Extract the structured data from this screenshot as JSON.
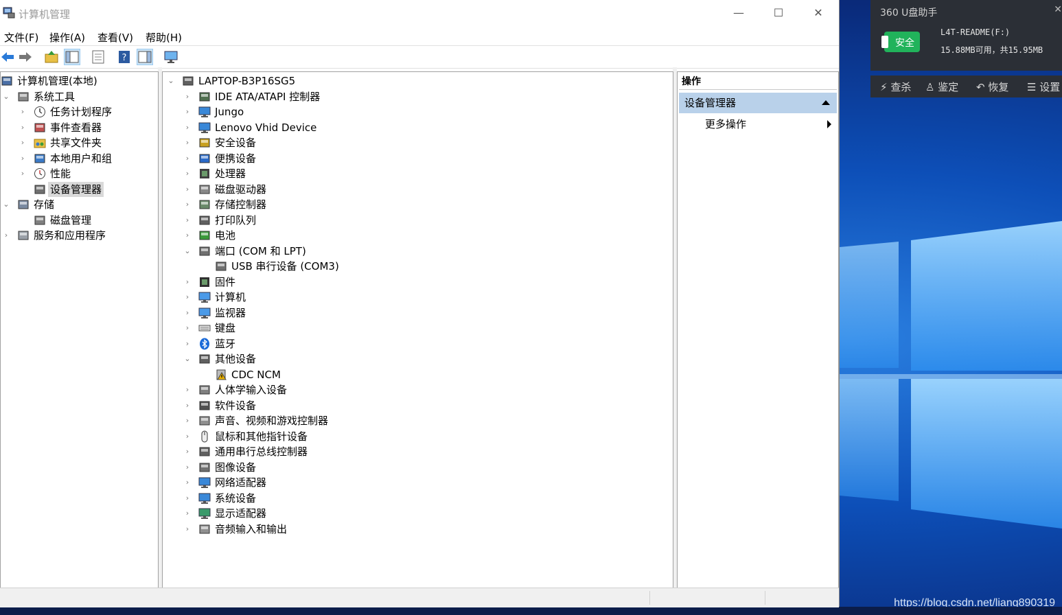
{
  "window": {
    "title": "计算机管理",
    "controls": {
      "minimize": "—",
      "maximize": "☐",
      "close": "✕"
    }
  },
  "menubar": [
    "文件(F)",
    "操作(A)",
    "查看(V)",
    "帮助(H)"
  ],
  "toolbar": [
    "back-icon",
    "forward-icon",
    "up-folder-icon",
    "show-hide-tree-icon",
    "properties-icon",
    "help-icon",
    "view-icon",
    "monitor-icon"
  ],
  "left_tree": [
    {
      "label": "计算机管理(本地)",
      "icon": "computer-management-icon",
      "level": 0,
      "chevron": ""
    },
    {
      "label": "系统工具",
      "icon": "tools-icon",
      "level": 1,
      "chevron": "⌄"
    },
    {
      "label": "任务计划程序",
      "icon": "clock-icon",
      "level": 2,
      "chevron": "›"
    },
    {
      "label": "事件查看器",
      "icon": "event-viewer-icon",
      "level": 2,
      "chevron": "›"
    },
    {
      "label": "共享文件夹",
      "icon": "shared-folder-icon",
      "level": 2,
      "chevron": "›"
    },
    {
      "label": "本地用户和组",
      "icon": "users-icon",
      "level": 2,
      "chevron": "›"
    },
    {
      "label": "性能",
      "icon": "performance-icon",
      "level": 2,
      "chevron": "›"
    },
    {
      "label": "设备管理器",
      "icon": "device-manager-icon",
      "level": 2,
      "chevron": "",
      "selected": true
    },
    {
      "label": "存储",
      "icon": "storage-icon",
      "level": 1,
      "chevron": "⌄"
    },
    {
      "label": "磁盘管理",
      "icon": "disk-management-icon",
      "level": 2,
      "chevron": ""
    },
    {
      "label": "服务和应用程序",
      "icon": "services-icon",
      "level": 1,
      "chevron": "›"
    }
  ],
  "device_tree": [
    {
      "label": "LAPTOP-B3P16SG5",
      "icon": "computer-root-icon",
      "level": 0,
      "chevron": "⌄"
    },
    {
      "label": "IDE ATA/ATAPI 控制器",
      "icon": "ide-controller-icon",
      "level": 1,
      "chevron": "›"
    },
    {
      "label": "Jungo",
      "icon": "jungo-icon",
      "level": 1,
      "chevron": "›"
    },
    {
      "label": "Lenovo Vhid Device",
      "icon": "vhid-device-icon",
      "level": 1,
      "chevron": "›"
    },
    {
      "label": "安全设备",
      "icon": "security-device-icon",
      "level": 1,
      "chevron": "›"
    },
    {
      "label": "便携设备",
      "icon": "portable-device-icon",
      "level": 1,
      "chevron": "›"
    },
    {
      "label": "处理器",
      "icon": "processor-icon",
      "level": 1,
      "chevron": "›"
    },
    {
      "label": "磁盘驱动器",
      "icon": "disk-drive-icon",
      "level": 1,
      "chevron": "›"
    },
    {
      "label": "存储控制器",
      "icon": "storage-controller-icon",
      "level": 1,
      "chevron": "›"
    },
    {
      "label": "打印队列",
      "icon": "printer-icon",
      "level": 1,
      "chevron": "›"
    },
    {
      "label": "电池",
      "icon": "battery-icon",
      "level": 1,
      "chevron": "›"
    },
    {
      "label": "端口 (COM 和 LPT)",
      "icon": "port-icon",
      "level": 1,
      "chevron": "⌄"
    },
    {
      "label": "USB 串行设备 (COM3)",
      "icon": "port-icon",
      "level": 2,
      "chevron": ""
    },
    {
      "label": "固件",
      "icon": "firmware-icon",
      "level": 1,
      "chevron": "›"
    },
    {
      "label": "计算机",
      "icon": "computer-icon",
      "level": 1,
      "chevron": "›"
    },
    {
      "label": "监视器",
      "icon": "monitor-icon",
      "level": 1,
      "chevron": "›"
    },
    {
      "label": "键盘",
      "icon": "keyboard-icon",
      "level": 1,
      "chevron": "›"
    },
    {
      "label": "蓝牙",
      "icon": "bluetooth-icon",
      "level": 1,
      "chevron": "›"
    },
    {
      "label": "其他设备",
      "icon": "unknown-device-icon",
      "level": 1,
      "chevron": "⌄"
    },
    {
      "label": "CDC NCM",
      "icon": "warning-device-icon",
      "level": 2,
      "chevron": ""
    },
    {
      "label": "人体学输入设备",
      "icon": "hid-icon",
      "level": 1,
      "chevron": "›"
    },
    {
      "label": "软件设备",
      "icon": "software-device-icon",
      "level": 1,
      "chevron": "›"
    },
    {
      "label": "声音、视频和游戏控制器",
      "icon": "speaker-icon",
      "level": 1,
      "chevron": "›"
    },
    {
      "label": "鼠标和其他指针设备",
      "icon": "mouse-icon",
      "level": 1,
      "chevron": "›"
    },
    {
      "label": "通用串行总线控制器",
      "icon": "usb-icon",
      "level": 1,
      "chevron": "›"
    },
    {
      "label": "图像设备",
      "icon": "camera-icon",
      "level": 1,
      "chevron": "›"
    },
    {
      "label": "网络适配器",
      "icon": "network-adapter-icon",
      "level": 1,
      "chevron": "›"
    },
    {
      "label": "系统设备",
      "icon": "system-device-icon",
      "level": 1,
      "chevron": "›"
    },
    {
      "label": "显示适配器",
      "icon": "display-adapter-icon",
      "level": 1,
      "chevron": "›"
    },
    {
      "label": "音频输入和输出",
      "icon": "audio-io-icon",
      "level": 1,
      "chevron": "›"
    }
  ],
  "actions": {
    "header": "操作",
    "group": "设备管理器",
    "more": "更多操作"
  },
  "u360": {
    "title": "360 U盘助手",
    "close": "✕",
    "badge": "安全",
    "drive_name": "L4T-README(F:)",
    "space": "15.88MB可用，共15.95MB",
    "actions": [
      "查杀",
      "鉴定",
      "恢复",
      "设置"
    ]
  },
  "watermark": "https://blog.csdn.net/liang890319",
  "colors": {
    "selection": "#d9d9d9",
    "action_group": "#b9d1ea",
    "u360_bg": "#2b2f36",
    "u360_badge": "#21b35b"
  }
}
